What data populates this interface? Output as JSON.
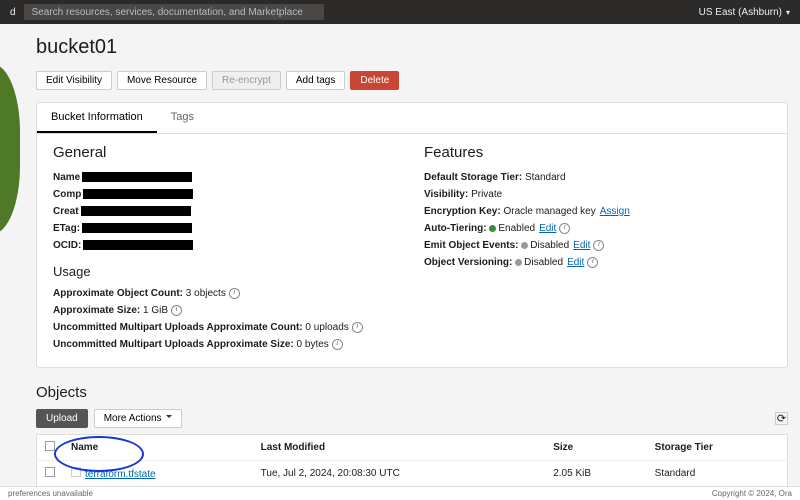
{
  "topbar": {
    "left_badge": "d",
    "search_placeholder": "Search resources, services, documentation, and Marketplace",
    "region": "US East (Ashburn)"
  },
  "page": {
    "title": "bucket01"
  },
  "actions": {
    "edit_visibility": "Edit Visibility",
    "move_resource": "Move Resource",
    "re_encrypt": "Re-encrypt",
    "add_tags": "Add tags",
    "delete": "Delete"
  },
  "tabs": {
    "bucket_info": "Bucket Information",
    "tags": "Tags"
  },
  "general": {
    "heading": "General",
    "namespace_label": "Name",
    "compartment_label": "Comp",
    "created_label": "Creat",
    "etag_label": "ETag:",
    "ocid_label": "OCID:"
  },
  "usage": {
    "heading": "Usage",
    "obj_count_label": "Approximate Object Count:",
    "obj_count_value": "3 objects",
    "size_label": "Approximate Size:",
    "size_value": "1 GiB",
    "mpu_count_label": "Uncommitted Multipart Uploads Approximate Count:",
    "mpu_count_value": "0 uploads",
    "mpu_size_label": "Uncommitted Multipart Uploads Approximate Size:",
    "mpu_size_value": "0 bytes"
  },
  "features": {
    "heading": "Features",
    "storage_tier_label": "Default Storage Tier:",
    "storage_tier_value": "Standard",
    "visibility_label": "Visibility:",
    "visibility_value": "Private",
    "enc_key_label": "Encryption Key:",
    "enc_key_value": "Oracle managed key",
    "assign": "Assign",
    "auto_tiering_label": "Auto-Tiering:",
    "auto_tiering_value": "Enabled",
    "emit_events_label": "Emit Object Events:",
    "emit_events_value": "Disabled",
    "versioning_label": "Object Versioning:",
    "versioning_value": "Disabled",
    "edit": "Edit"
  },
  "objects": {
    "heading": "Objects",
    "upload": "Upload",
    "more_actions": "More Actions",
    "col_name": "Name",
    "col_modified": "Last Modified",
    "col_size": "Size",
    "col_tier": "Storage Tier",
    "row": {
      "name": "terraform.tfstate",
      "modified": "Tue, Jul 2, 2024, 20:08:30 UTC",
      "size": "2.05 KiB",
      "tier": "Standard"
    }
  },
  "footer": {
    "left": "preferences unavailable",
    "right": "Copyright © 2024, Ora"
  }
}
